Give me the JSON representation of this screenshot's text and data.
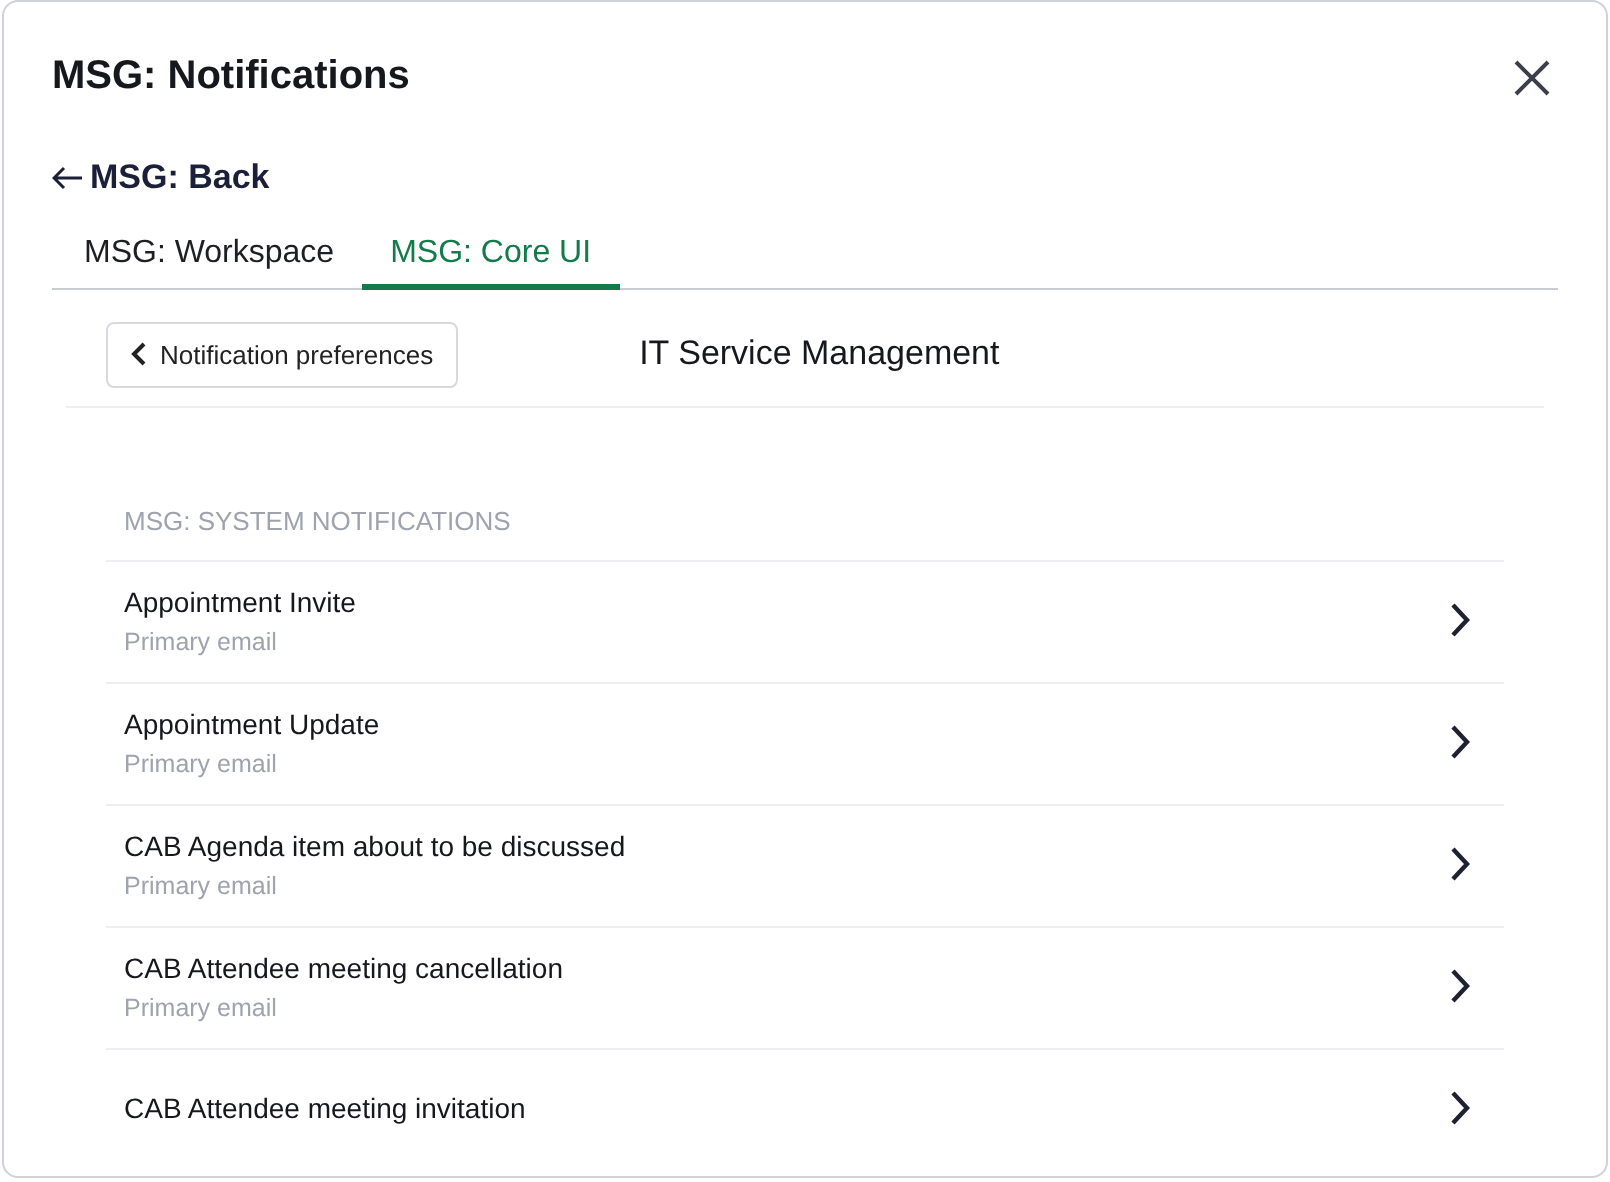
{
  "dialog": {
    "title": "MSG: Notifications"
  },
  "back_link": "MSG: Back",
  "tabs": [
    {
      "label": "MSG: Workspace",
      "selected": false
    },
    {
      "label": "MSG: Core UI",
      "selected": true
    }
  ],
  "preferences_button": "Notification preferences",
  "page_title": "IT Service Management",
  "section": {
    "heading": "MSG: SYSTEM NOTIFICATIONS",
    "items": [
      {
        "title": "Appointment Invite",
        "subtitle": "Primary email"
      },
      {
        "title": "Appointment Update",
        "subtitle": "Primary email"
      },
      {
        "title": "CAB Agenda item about to be discussed",
        "subtitle": "Primary email"
      },
      {
        "title": "CAB Attendee meeting cancellation",
        "subtitle": "Primary email"
      },
      {
        "title": "CAB Attendee meeting invitation"
      }
    ]
  }
}
